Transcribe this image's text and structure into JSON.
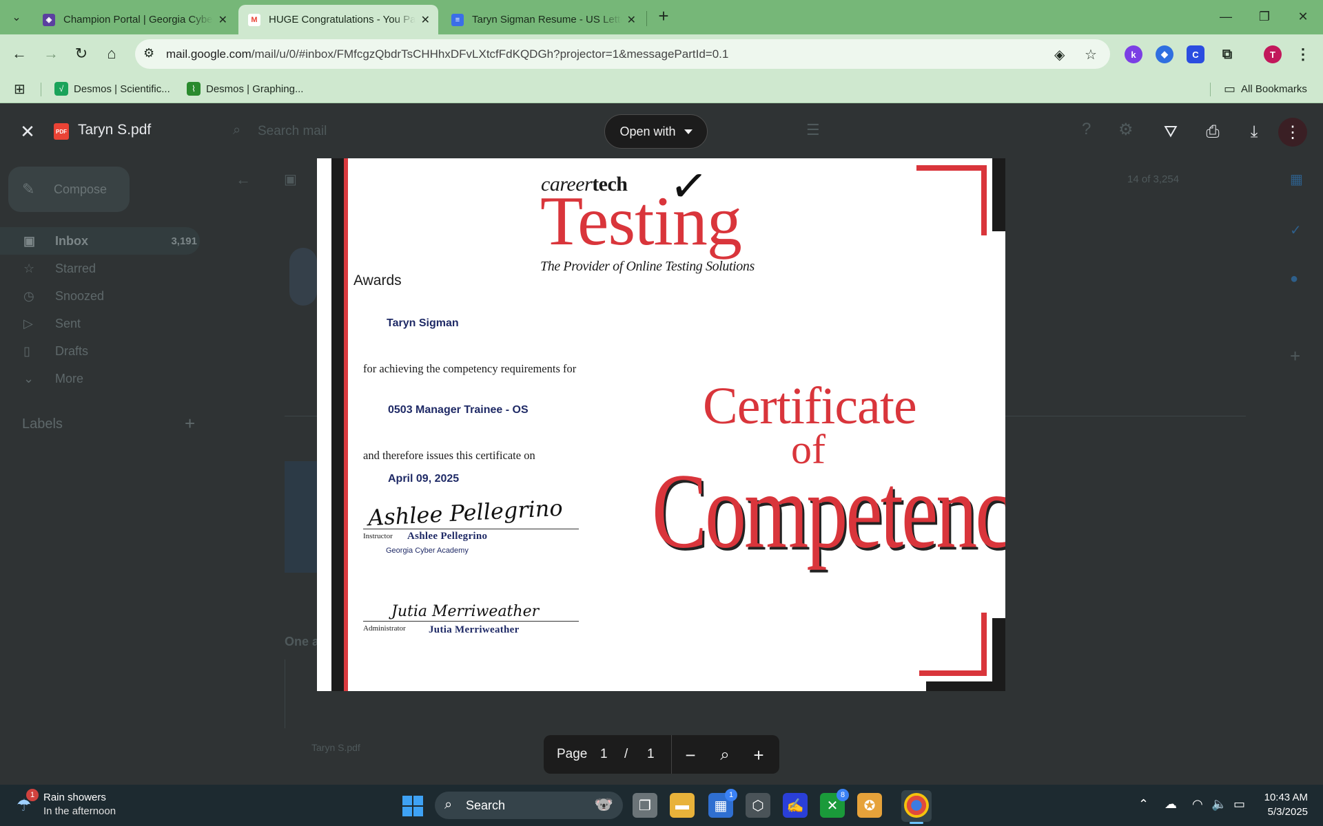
{
  "browser": {
    "tabs": [
      {
        "title": "Champion Portal | Georgia Cyber Academy",
        "favicon_color": "#5b3fa0",
        "favicon": "◈",
        "active": false
      },
      {
        "title": "HUGE Congratulations - You Passed",
        "favicon_color": "#ffffff",
        "favicon": "M",
        "active": true
      },
      {
        "title": "Taryn Sigman Resume - US Letter",
        "favicon_color": "#3b6ee8",
        "favicon": "≡",
        "active": false
      }
    ],
    "url_host": "mail.google.com",
    "url_path": "/mail/u/0/#inbox/FMfcgzQbdrTsCHHhxDFvLXtcfFdKQDGh?projector=1&messagePartId=0.1",
    "profile_initial": "T",
    "bookmarks": [
      {
        "label": "Desmos | Scientific...",
        "color": "#1aa35a"
      },
      {
        "label": "Desmos | Graphing...",
        "color": "#2a8a2e"
      }
    ],
    "all_bookmarks": "All Bookmarks",
    "extensions": [
      {
        "letter": "k",
        "color": "#7b3fe4"
      },
      {
        "letter": "◆",
        "color": "#2f6fe0"
      },
      {
        "letter": "C",
        "color": "#2b4de0"
      }
    ]
  },
  "gmail": {
    "compose": "Compose",
    "nav": [
      {
        "label": "Inbox",
        "count": "3,191",
        "icon": "inbox-icon"
      },
      {
        "label": "Starred",
        "count": "",
        "icon": "star-icon"
      },
      {
        "label": "Snoozed",
        "count": "",
        "icon": "clock-icon"
      },
      {
        "label": "Sent",
        "count": "",
        "icon": "send-icon"
      },
      {
        "label": "Drafts",
        "count": "",
        "icon": "draft-icon"
      },
      {
        "label": "More",
        "count": "",
        "icon": "chevron-down-icon"
      }
    ],
    "labels_heading": "Labels",
    "search_placeholder": "Search mail",
    "pagination": "14 of 3,254",
    "attachment_name": "Taryn S.pdf",
    "reply_heading": "One a"
  },
  "viewer": {
    "file_name": "Taryn S.pdf",
    "open_with": "Open with",
    "page_label": "Page",
    "current_page": "1",
    "separator": "/",
    "total_pages": "1"
  },
  "certificate": {
    "logo_career": "career",
    "logo_tech": "tech",
    "logo_testing": "Testing",
    "logo_tagline": "The Provider of Online Testing Solutions",
    "awards": "Awards",
    "candidate": "Taryn Sigman",
    "line_requirements": "for achieving the competency requirements for",
    "course": "0503 Manager Trainee - OS",
    "line_issues": "and therefore issues this certificate on",
    "date": "April 09, 2025",
    "instructor_role": "Instructor",
    "instructor_name": "Ashlee Pellegrino",
    "instructor_org": "Georgia Cyber Academy",
    "admin_role": "Administrator",
    "admin_name": "Jutia Merriweather",
    "title_1": "Certificate",
    "title_2": "of",
    "title_3": "Competency"
  },
  "taskbar": {
    "weather_title": "Rain showers",
    "weather_sub": "In the afternoon",
    "weather_badge": "1",
    "search": "Search",
    "store_badge": "1",
    "xbox_badge": "8",
    "time": "10:43 AM",
    "date": "5/3/2025"
  }
}
